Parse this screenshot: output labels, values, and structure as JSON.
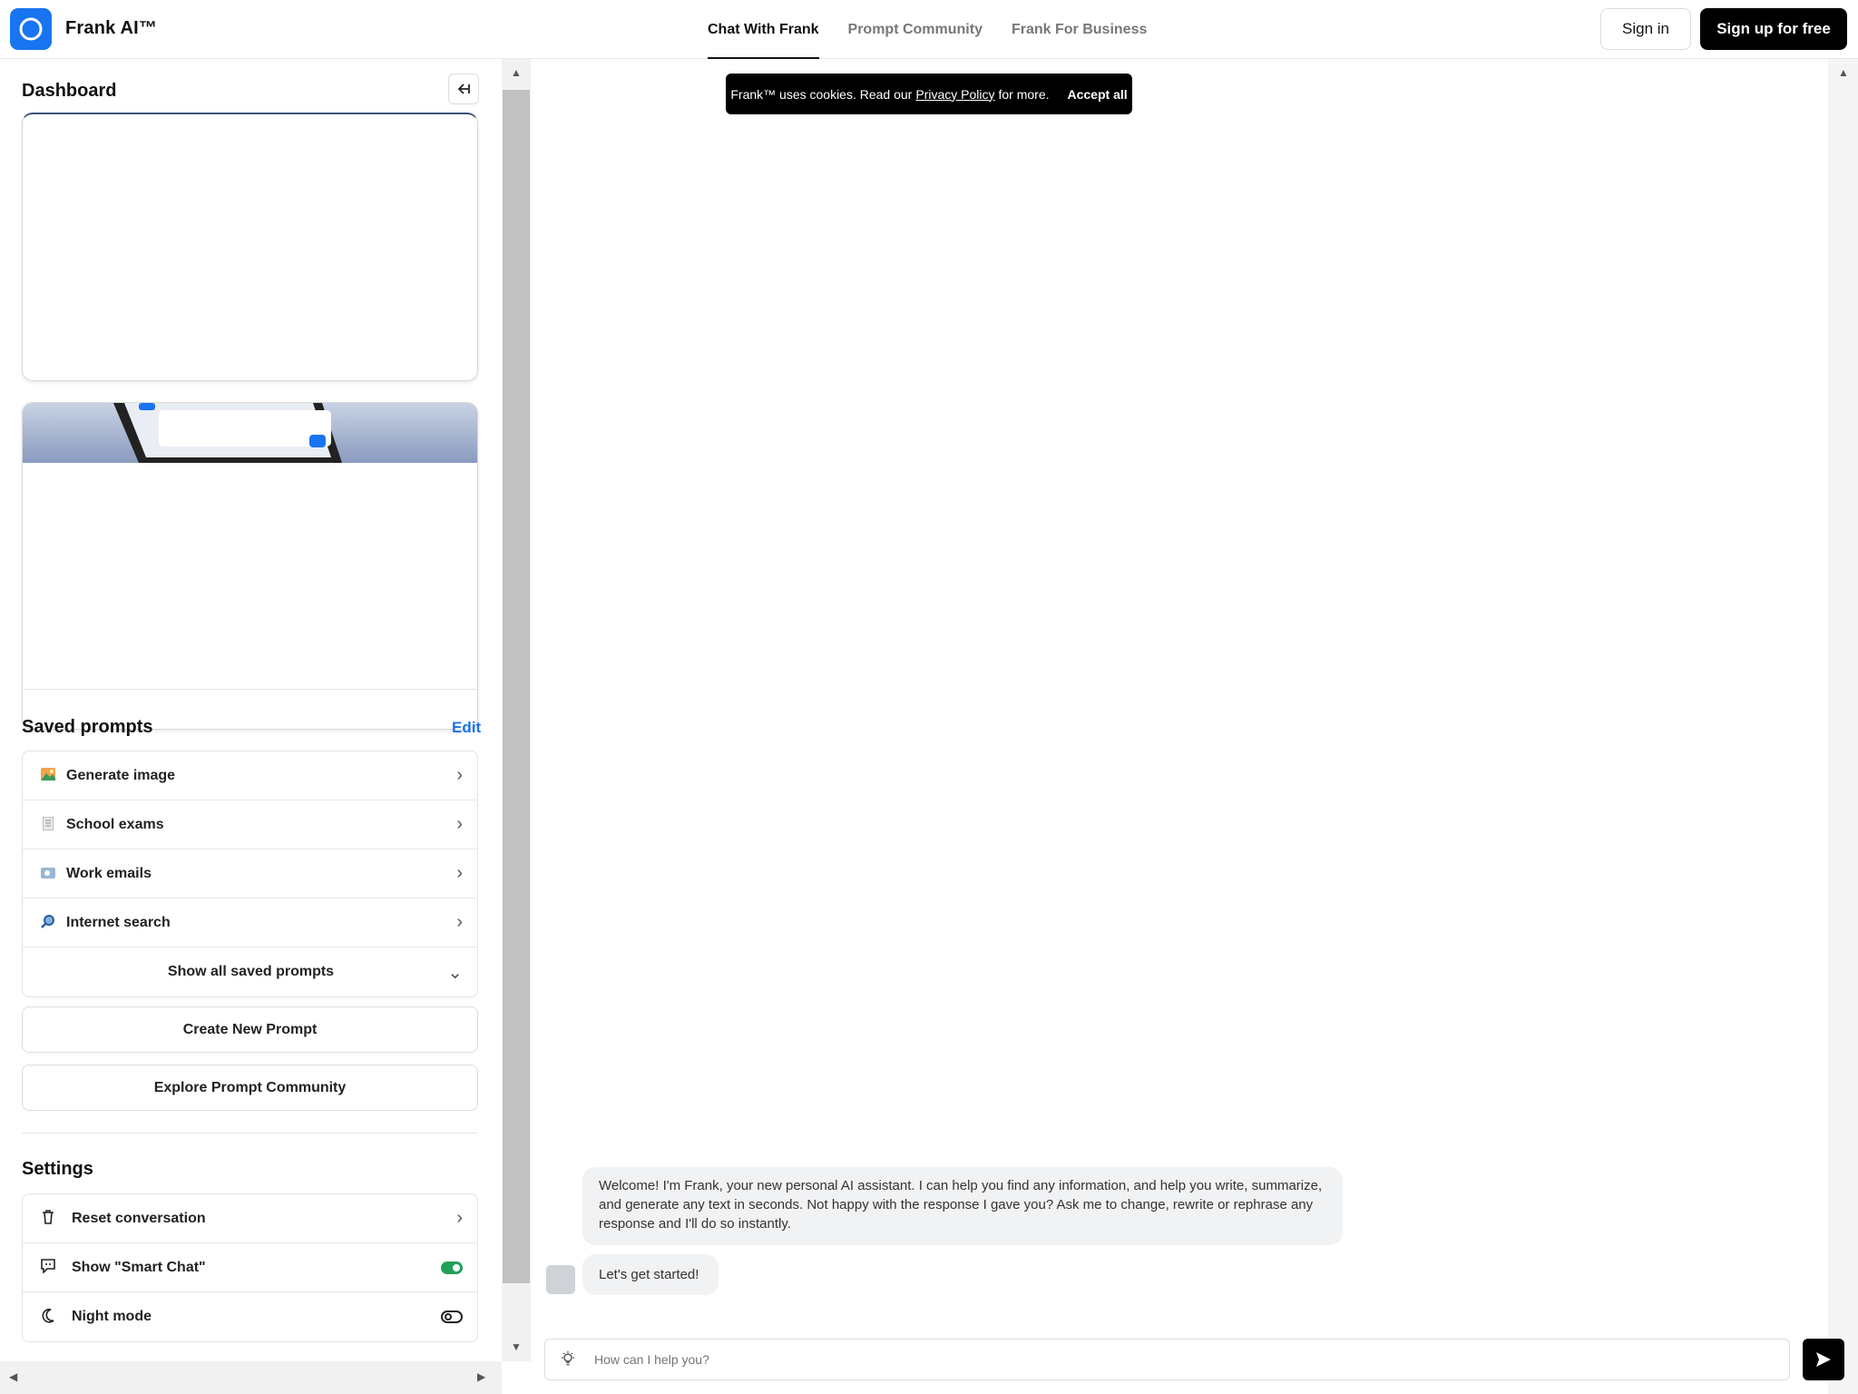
{
  "header": {
    "brand": "Frank AI™",
    "nav": [
      "Chat With Frank",
      "Prompt Community",
      "Frank For Business"
    ],
    "sign_in": "Sign in",
    "sign_up": "Sign up for free",
    "accent": "#1874f0"
  },
  "sidebar": {
    "title": "Dashboard",
    "saved_title": "Saved prompts",
    "edit_label": "Edit",
    "prompts": [
      {
        "icon": "picture-icon",
        "label": "Generate image"
      },
      {
        "icon": "notebook-icon",
        "label": "School exams"
      },
      {
        "icon": "mailbox-icon",
        "label": "Work emails"
      },
      {
        "icon": "magnifier-icon",
        "label": "Internet search"
      }
    ],
    "show_all": "Show all saved prompts",
    "create_prompt": "Create New Prompt",
    "explore": "Explore Prompt Community",
    "settings_title": "Settings",
    "settings": [
      {
        "icon": "trash-icon",
        "label": "Reset conversation",
        "control": "chevron"
      },
      {
        "icon": "chat-icon",
        "label": "Show \"Smart Chat\"",
        "control": "toggle",
        "enabled": true
      },
      {
        "icon": "moon-icon",
        "label": "Night mode",
        "control": "toggle",
        "enabled": false
      }
    ]
  },
  "cookie": {
    "text": "Frank™ uses cookies. Read our",
    "link": "Privacy Policy",
    "suffix": "for more.",
    "accept": "Accept all"
  },
  "chat": {
    "welcome": "Welcome! I'm Frank, your new personal AI assistant. I can help you find any information, and help you write, summarize, and generate any text in seconds. Not happy with the response I gave you? Ask me to change, rewrite or rephrase any response and I'll do so instantly.",
    "start": "Let's get started!",
    "placeholder": "How can I help you?"
  }
}
